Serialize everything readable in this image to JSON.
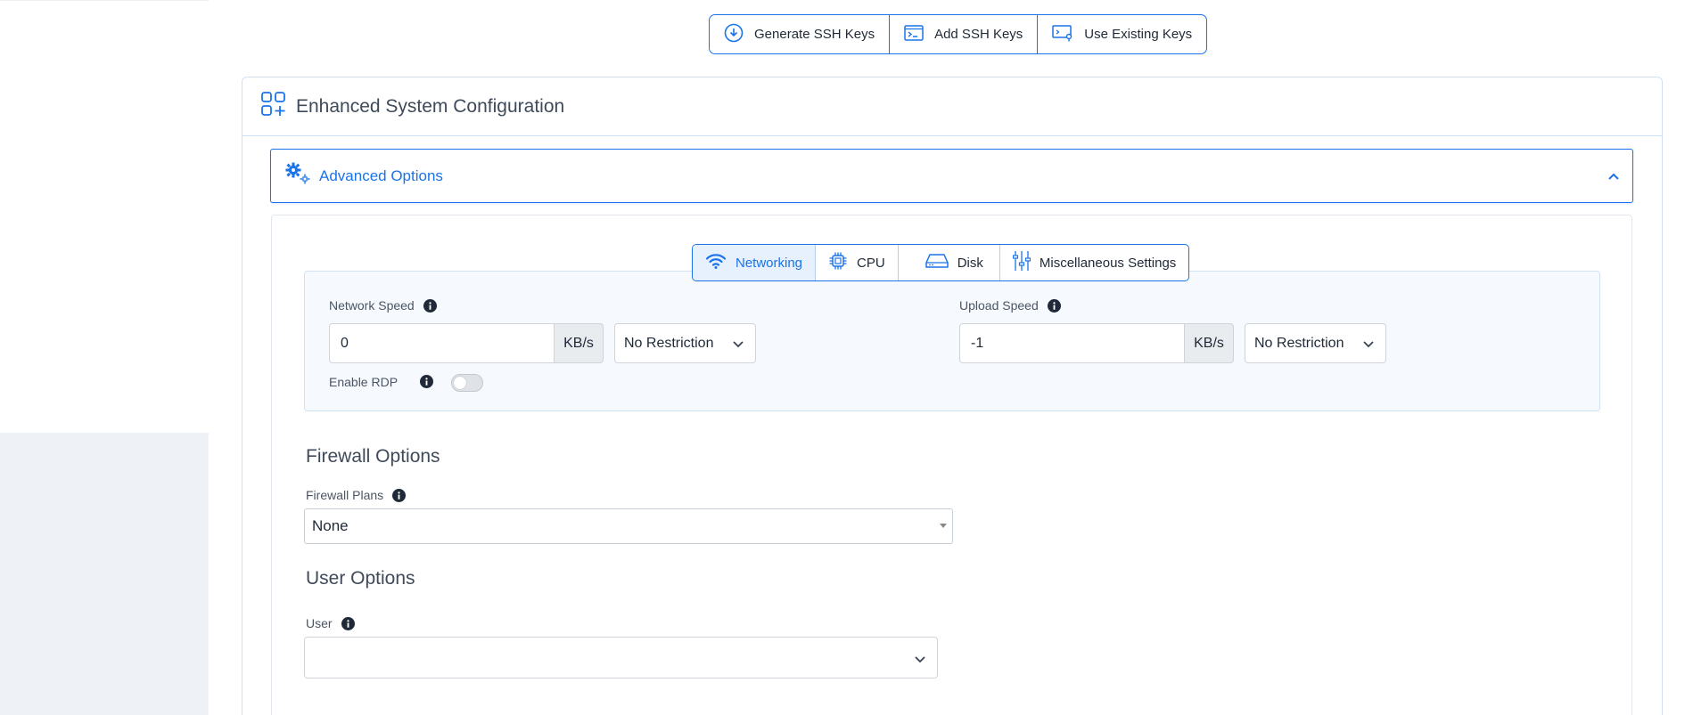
{
  "ssh_toolbar": {
    "generate_label": "Generate SSH Keys",
    "add_label": "Add SSH Keys",
    "existing_label": "Use Existing Keys"
  },
  "config": {
    "title": "Enhanced System Configuration"
  },
  "advanced": {
    "title": "Advanced Options",
    "expanded": true
  },
  "tabs": [
    {
      "label": "Networking",
      "icon": "wifi-icon",
      "active": true
    },
    {
      "label": "CPU",
      "icon": "cpu-chip-icon",
      "active": false
    },
    {
      "label": "Disk",
      "icon": "hard-drive-icon",
      "active": false
    },
    {
      "label": "Miscellaneous Settings",
      "icon": "sliders-icon",
      "active": false
    }
  ],
  "networking": {
    "network_speed": {
      "label": "Network Speed",
      "value": "0",
      "unit": "KB/s",
      "restriction": "No Restriction"
    },
    "upload_speed": {
      "label": "Upload Speed",
      "value": "-1",
      "unit": "KB/s",
      "restriction": "No Restriction"
    },
    "enable_rdp": {
      "label": "Enable RDP",
      "enabled": false
    }
  },
  "firewall": {
    "section_title": "Firewall Options",
    "plans_label": "Firewall Plans",
    "plans_value": "None"
  },
  "user_options": {
    "section_title": "User Options",
    "user_label": "User",
    "user_value": ""
  },
  "colors": {
    "accent": "#1a73e8",
    "panel_bg": "#f6f9fd",
    "sidebar_bg": "#eef2f6"
  }
}
